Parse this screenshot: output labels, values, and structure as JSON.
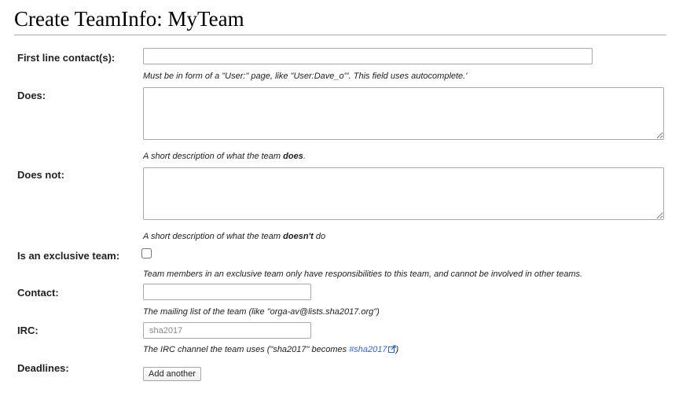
{
  "page": {
    "title": "Create TeamInfo: MyTeam"
  },
  "form": {
    "first_line_contact": {
      "label": "First line contact(s):",
      "value": "",
      "help": "Must be in form of a \"User:\" page, like \"User:Dave_o\"'. This field uses autocomplete.'"
    },
    "does": {
      "label": "Does:",
      "value": "",
      "help_prefix": "A short description of what the team ",
      "help_bold": "does",
      "help_suffix": "."
    },
    "does_not": {
      "label": "Does not:",
      "value": "",
      "help_prefix": "A short description of what the team ",
      "help_bold": "doesn't",
      "help_suffix": " do"
    },
    "exclusive": {
      "label": "Is an exclusive team:",
      "checked": false,
      "help": "Team members in an exclusive team only have responsibilities to this team, and cannot be involved in other teams."
    },
    "contact": {
      "label": "Contact:",
      "value": "",
      "help": "The mailing list of the team (like \"orga-av@lists.sha2017.org\")"
    },
    "irc": {
      "label": "IRC:",
      "value": "",
      "placeholder": "sha2017",
      "help_prefix": "The IRC channel the team uses (\"sha2017\" becomes ",
      "help_link": "#sha2017",
      "help_suffix": ")",
      "link_icon": "external-link-icon",
      "link_color": "#3366cc"
    },
    "deadlines": {
      "label": "Deadlines:",
      "add_button": "Add another"
    }
  }
}
